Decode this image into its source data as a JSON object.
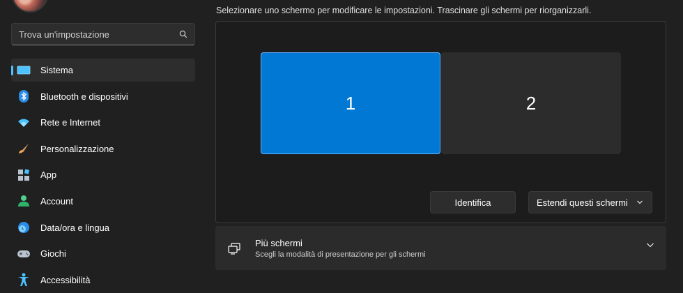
{
  "search": {
    "placeholder": "Trova un'impostazione"
  },
  "sidebar": {
    "items": [
      {
        "label": "Sistema",
        "icon": "monitor-icon",
        "active": true
      },
      {
        "label": "Bluetooth e dispositivi",
        "icon": "bluetooth-icon"
      },
      {
        "label": "Rete e Internet",
        "icon": "wifi-icon"
      },
      {
        "label": "Personalizzazione",
        "icon": "brush-icon"
      },
      {
        "label": "App",
        "icon": "apps-icon"
      },
      {
        "label": "Account",
        "icon": "person-icon"
      },
      {
        "label": "Data/ora e lingua",
        "icon": "globe-clock-icon"
      },
      {
        "label": "Giochi",
        "icon": "gamepad-icon"
      },
      {
        "label": "Accessibilità",
        "icon": "accessibility-icon"
      }
    ]
  },
  "main": {
    "instruction": "Selezionare uno schermo per modificare le impostazioni. Trascinare gli schermi per riorganizzarli.",
    "monitors": [
      "1",
      "2"
    ],
    "identify_label": "Identifica",
    "extend_label": "Estendi questi schermi",
    "multi_displays": {
      "title": "Più schermi",
      "subtitle": "Scegli la modalità di presentazione per gli schermi"
    }
  },
  "colors": {
    "accent": "#0078d4",
    "background": "#202020",
    "active_indicator": "#4cc2ff"
  }
}
